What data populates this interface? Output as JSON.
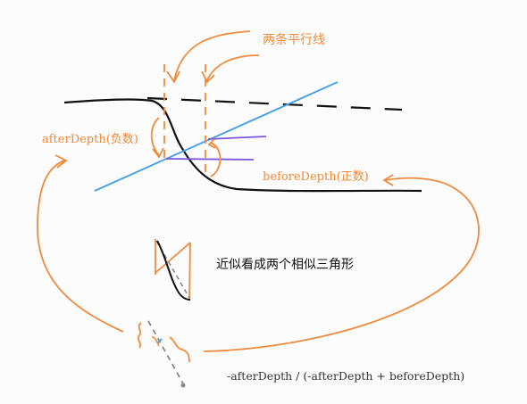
{
  "labels": {
    "parallel_lines": "两条平行线",
    "after_depth": "afterDepth(负数)",
    "before_depth": "beforeDepth(正数)",
    "similar_triangles": "近似看成两个相似三角形",
    "formula": "-afterDepth / (-afterDepth + beforeDepth)"
  },
  "colors": {
    "orange": "#f08a3c",
    "blue": "#4aa3e8",
    "purple": "#7a55e0",
    "black": "#111111",
    "gray": "#888888"
  }
}
